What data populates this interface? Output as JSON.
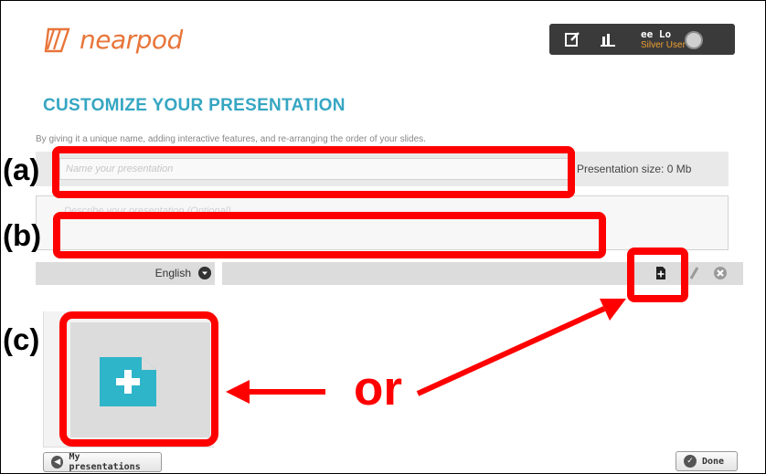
{
  "header": {
    "logo_text": "nearpod",
    "user": {
      "name": "ee Lo",
      "level": "Silver User"
    },
    "icons": [
      "edit-icon",
      "reports-icon",
      "silver-badge-icon"
    ]
  },
  "page": {
    "title": "CUSTOMIZE YOUR PRESENTATION",
    "subtitle": "By giving it a unique name, adding interactive features, and re-arranging the order of your slides."
  },
  "form": {
    "name_placeholder": "Name your presentation",
    "name_value": "",
    "presentation_size": "Presentation size: 0 Mb",
    "description_placeholder": "Describe your presentation (Optional)",
    "description_value": "",
    "language": "English"
  },
  "buttons": {
    "back": "My presentations",
    "done": "Done"
  },
  "annotations": {
    "a": "(a)",
    "b": "(b)",
    "c": "(c)",
    "or": "or"
  },
  "colors": {
    "brand": "#e8753a",
    "title": "#36a6c2",
    "add_slide": "#2fb5c9",
    "highlight": "#ff0000"
  }
}
